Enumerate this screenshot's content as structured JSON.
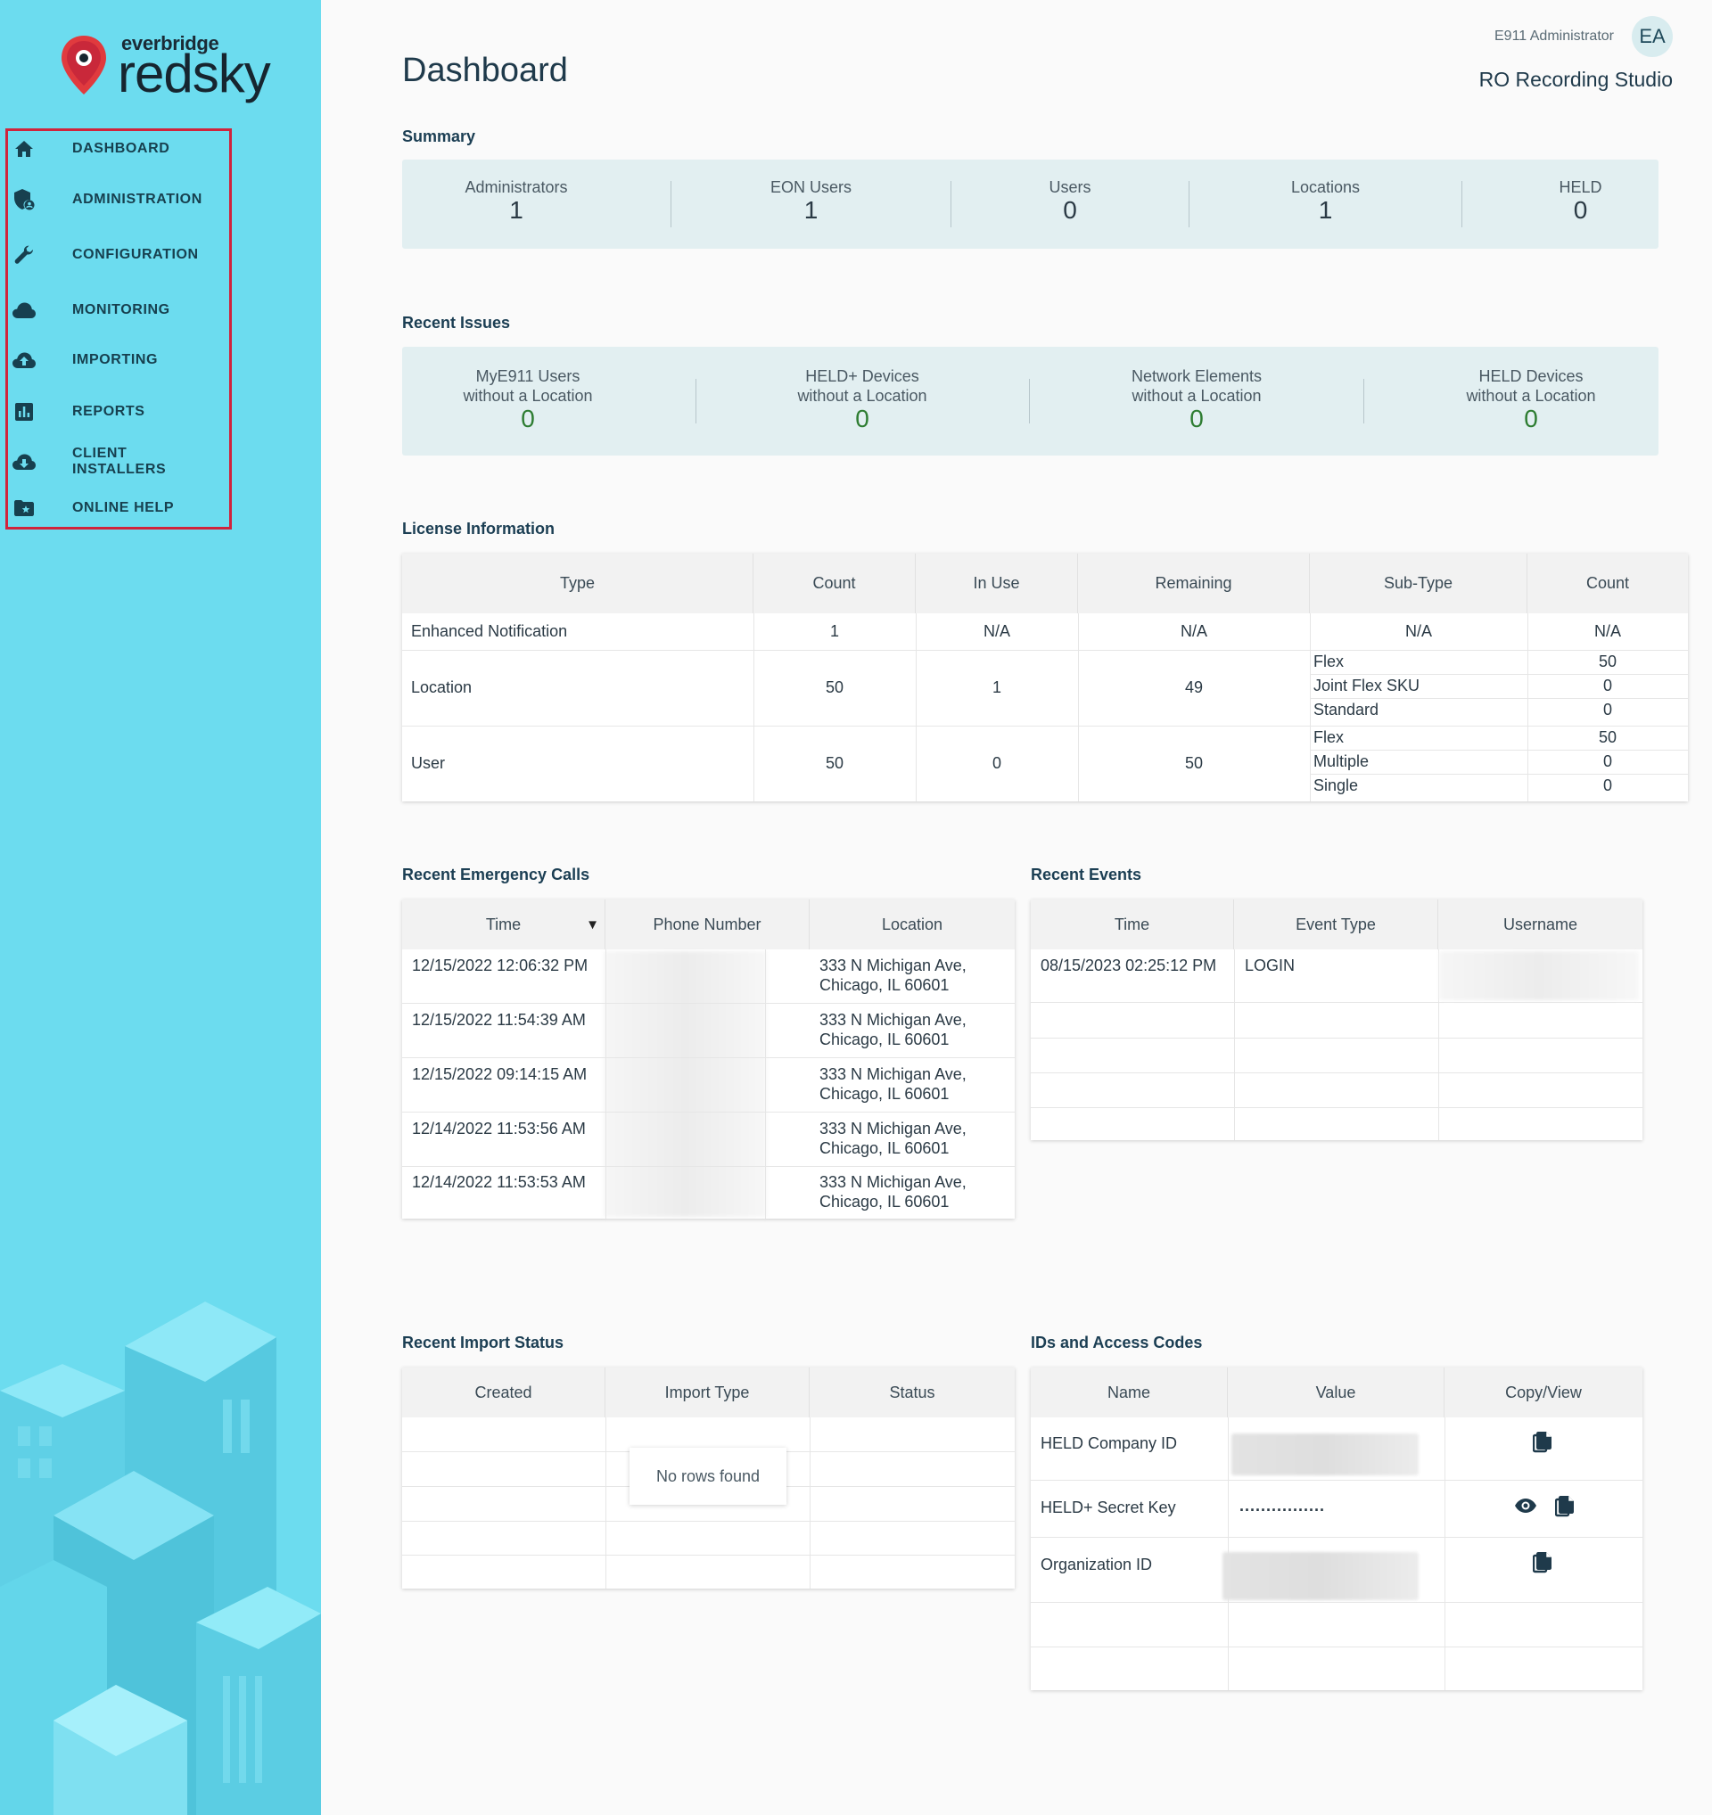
{
  "brand": {
    "small": "everbridge",
    "big": "redsky"
  },
  "sidebar": {
    "items": [
      {
        "label": "DASHBOARD",
        "icon": "home-icon"
      },
      {
        "label": "ADMINISTRATION",
        "icon": "shield-user-icon"
      },
      {
        "label": "CONFIGURATION",
        "icon": "wrench-icon"
      },
      {
        "label": "MONITORING",
        "icon": "cloud-icon"
      },
      {
        "label": "IMPORTING",
        "icon": "cloud-upload-icon"
      },
      {
        "label": "REPORTS",
        "icon": "bar-chart-icon"
      },
      {
        "label": "CLIENT INSTALLERS",
        "icon": "cloud-download-icon"
      },
      {
        "label": "ONLINE HELP",
        "icon": "folder-star-icon"
      }
    ]
  },
  "header": {
    "title": "Dashboard",
    "user_role": "E911 Administrator",
    "avatar_initials": "EA",
    "org_name": "RO Recording Studio"
  },
  "summary": {
    "title": "Summary",
    "stats": [
      {
        "label": "Administrators",
        "value": "1"
      },
      {
        "label": "EON Users",
        "value": "1"
      },
      {
        "label": "Users",
        "value": "0"
      },
      {
        "label": "Locations",
        "value": "1"
      },
      {
        "label": "HELD",
        "value": "0"
      }
    ]
  },
  "recent_issues": {
    "title": "Recent Issues",
    "stats": [
      {
        "line1": "MyE911 Users",
        "line2": "without a Location",
        "value": "0"
      },
      {
        "line1": "HELD+ Devices",
        "line2": "without a Location",
        "value": "0"
      },
      {
        "line1": "Network Elements",
        "line2": "without a Location",
        "value": "0"
      },
      {
        "line1": "HELD Devices",
        "line2": "without a Location",
        "value": "0"
      }
    ]
  },
  "license": {
    "title": "License Information",
    "headers": [
      "Type",
      "Count",
      "In Use",
      "Remaining",
      "Sub-Type",
      "Count"
    ],
    "rows": [
      {
        "type": "Enhanced Notification",
        "count": "1",
        "in_use": "N/A",
        "remaining": "N/A",
        "subtypes": [
          {
            "name": "N/A",
            "count": "N/A"
          }
        ]
      },
      {
        "type": "Location",
        "count": "50",
        "in_use": "1",
        "remaining": "49",
        "subtypes": [
          {
            "name": "Flex",
            "count": "50"
          },
          {
            "name": "Joint Flex SKU",
            "count": "0"
          },
          {
            "name": "Standard",
            "count": "0"
          }
        ]
      },
      {
        "type": "User",
        "count": "50",
        "in_use": "0",
        "remaining": "50",
        "subtypes": [
          {
            "name": "Flex",
            "count": "50"
          },
          {
            "name": "Multiple",
            "count": "0"
          },
          {
            "name": "Single",
            "count": "0"
          }
        ]
      }
    ]
  },
  "emergency_calls": {
    "title": "Recent Emergency Calls",
    "headers": [
      "Time",
      "Phone Number",
      "Location"
    ],
    "sort_indicator": "▼",
    "rows": [
      {
        "time": "12/15/2022 12:06:32 PM",
        "loc1": "333 N Michigan Ave,",
        "loc2": "Chicago, IL 60601"
      },
      {
        "time": "12/15/2022 11:54:39 AM",
        "loc1": "333 N Michigan Ave,",
        "loc2": "Chicago, IL 60601"
      },
      {
        "time": "12/15/2022 09:14:15 AM",
        "loc1": "333 N Michigan Ave,",
        "loc2": "Chicago, IL 60601"
      },
      {
        "time": "12/14/2022 11:53:56 AM",
        "loc1": "333 N Michigan Ave,",
        "loc2": "Chicago, IL 60601"
      },
      {
        "time": "12/14/2022 11:53:53 AM",
        "loc1": "333 N Michigan Ave,",
        "loc2": "Chicago, IL 60601"
      }
    ]
  },
  "events": {
    "title": "Recent Events",
    "headers": [
      "Time",
      "Event Type",
      "Username"
    ],
    "rows": [
      {
        "time": "08/15/2023 02:25:12 PM",
        "type": "LOGIN"
      }
    ]
  },
  "imports": {
    "title": "Recent Import Status",
    "headers": [
      "Created",
      "Import Type",
      "Status"
    ],
    "empty": "No rows found"
  },
  "ids": {
    "title": "IDs and Access Codes",
    "headers": [
      "Name",
      "Value",
      "Copy/View"
    ],
    "rows": [
      {
        "name": "HELD Company ID"
      },
      {
        "name": "HELD+ Secret Key",
        "value": "................"
      },
      {
        "name": "Organization ID"
      }
    ]
  },
  "colors": {
    "sidebar": "#6cdcef",
    "accent_red": "#d0243c",
    "green_value": "#2e7d32",
    "panel": "#e2eff1"
  }
}
